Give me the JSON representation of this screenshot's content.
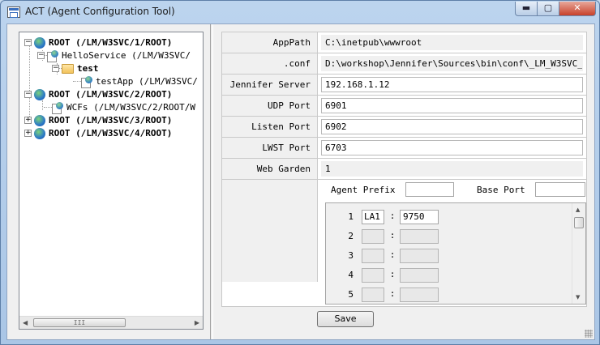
{
  "window": {
    "title": "ACT (Agent Configuration Tool)",
    "minimize": "▬",
    "maximize": "▢",
    "close": "✕"
  },
  "tree": {
    "nodes": [
      {
        "label": "ROOT (/LM/W3SVC/1/ROOT)",
        "bold": true,
        "icon": "globe-icon",
        "expander": "−"
      },
      {
        "label": "HelloService (/LM/W3SVC/",
        "bold": false,
        "icon": "app-node-icon",
        "expander": "−"
      },
      {
        "label": "test",
        "bold": true,
        "icon": "folder-icon",
        "expander": "−"
      },
      {
        "label": "testApp (/LM/W3SVC/",
        "bold": false,
        "icon": "app-node-icon",
        "expander": ""
      },
      {
        "label": "ROOT (/LM/W3SVC/2/ROOT)",
        "bold": true,
        "icon": "globe-icon",
        "expander": "−"
      },
      {
        "label": "WCFs (/LM/W3SVC/2/ROOT/W",
        "bold": false,
        "icon": "app-node-icon",
        "expander": ""
      },
      {
        "label": "ROOT (/LM/W3SVC/3/ROOT)",
        "bold": true,
        "icon": "globe-icon",
        "expander": "+"
      },
      {
        "label": "ROOT (/LM/W3SVC/4/ROOT)",
        "bold": true,
        "icon": "globe-icon",
        "expander": "+"
      }
    ],
    "scroll_left": "◀",
    "scroll_right": "▶",
    "scroll_grip": "III"
  },
  "properties": {
    "app_path": {
      "label": "AppPath",
      "value": "C:\\inetpub\\wwwroot"
    },
    "conf": {
      "label": ".conf",
      "value": "D:\\workshop\\Jennifer\\Sources\\bin\\conf\\_LM_W3SVC_"
    },
    "jennifer_server": {
      "label": "Jennifer Server",
      "value": "192.168.1.12"
    },
    "udp_port": {
      "label": "UDP Port",
      "value": "6901"
    },
    "listen_port": {
      "label": "Listen Port",
      "value": "6902"
    },
    "lwst_port": {
      "label": "LWST Port",
      "value": "6703"
    },
    "web_garden": {
      "label": "Web Garden",
      "value": "1"
    }
  },
  "agents": {
    "prefix_label": "Agent Prefix",
    "prefix_value": "",
    "base_port_label": "Base Port",
    "base_port_value": "",
    "rows": [
      {
        "num": "1",
        "prefix": "LA1",
        "port": "9750"
      },
      {
        "num": "2",
        "prefix": "",
        "port": ""
      },
      {
        "num": "3",
        "prefix": "",
        "port": ""
      },
      {
        "num": "4",
        "prefix": "",
        "port": ""
      },
      {
        "num": "5",
        "prefix": "",
        "port": ""
      }
    ],
    "colon": ":",
    "scroll_up": "▲",
    "scroll_down": "▼"
  },
  "actions": {
    "save_label": "Save"
  }
}
